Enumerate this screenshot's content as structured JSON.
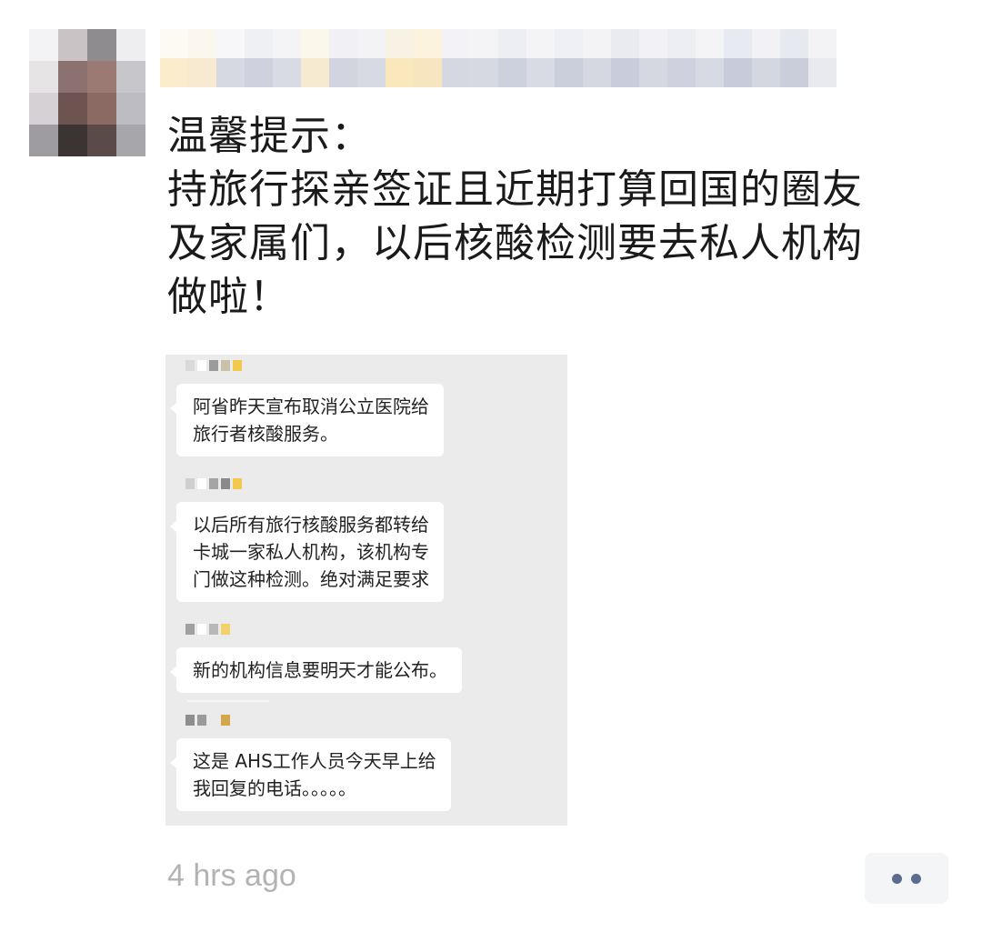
{
  "post": {
    "lines": [
      "温馨提示：",
      "持旅行探亲签证且近期打算回国的圈友",
      "及家属们，以后核酸检测要去私人机构",
      "做啦！"
    ],
    "timestamp": "4 hrs ago"
  },
  "chat": {
    "messages": [
      {
        "text": "阿省昨天宣布取消公立医院给\n旅行者核酸服务。"
      },
      {
        "text": "以后所有旅行核酸服务都转给\n卡城一家私人机构，该机构专\n门做这种检测。绝对满足要求"
      },
      {
        "text": "新的机构信息要明天才能公布。"
      },
      {
        "text": "这是 AHS工作人员今天早上给\n我回复的电话。。。。。"
      }
    ]
  },
  "actions": {
    "more_icon": "more-dots-icon"
  },
  "colors": {
    "accent": "#5b6c8f",
    "timestamp": "#b3b3b3",
    "chat_bg": "#ebebeb"
  }
}
